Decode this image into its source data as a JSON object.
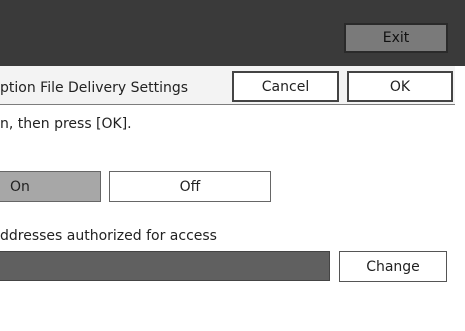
{
  "header": {
    "exit_label": "Exit"
  },
  "dialog": {
    "title": "ption File Delivery Settings",
    "cancel_label": "Cancel",
    "ok_label": "OK",
    "instruction": "n, then press [OK]."
  },
  "toggle": {
    "on_label": "On",
    "off_label": "Off",
    "selected": "On"
  },
  "access": {
    "label": "ddresses authorized for access",
    "value": "",
    "change_label": "Change"
  },
  "colors": {
    "topbar": "#3a3a3a",
    "selected_toggle": "#a7a7a7",
    "address_field": "#606060"
  }
}
